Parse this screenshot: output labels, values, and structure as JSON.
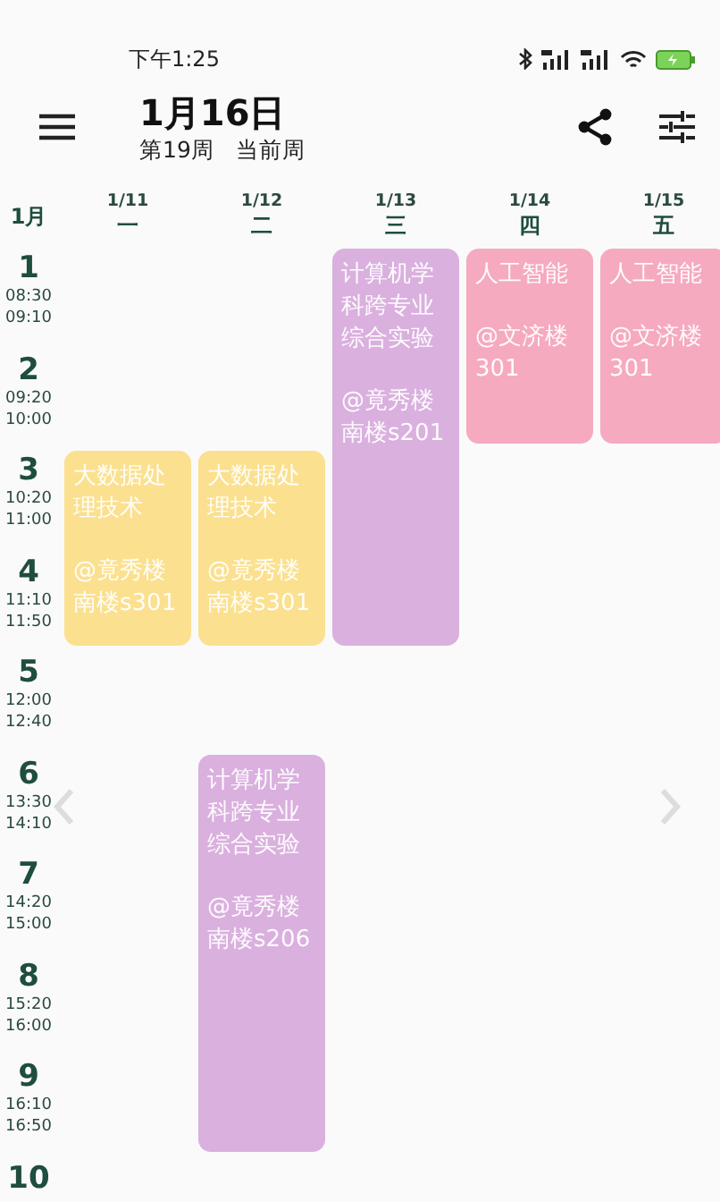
{
  "status_bar": {
    "time": "下午1:25"
  },
  "header": {
    "date": "1月16日",
    "week": "第19周",
    "week_status": "当前周"
  },
  "month": "1月",
  "periods": [
    {
      "number": "1",
      "start": "08:30",
      "end": "09:10"
    },
    {
      "number": "2",
      "start": "09:20",
      "end": "10:00"
    },
    {
      "number": "3",
      "start": "10:20",
      "end": "11:00"
    },
    {
      "number": "4",
      "start": "11:10",
      "end": "11:50"
    },
    {
      "number": "5",
      "start": "12:00",
      "end": "12:40"
    },
    {
      "number": "6",
      "start": "13:30",
      "end": "14:10"
    },
    {
      "number": "7",
      "start": "14:20",
      "end": "15:00"
    },
    {
      "number": "8",
      "start": "15:20",
      "end": "16:00"
    },
    {
      "number": "9",
      "start": "16:10",
      "end": "16:50"
    },
    {
      "number": "10"
    }
  ],
  "days": [
    {
      "date": "1/11",
      "weekday": "一",
      "slots": [
        {
          "kind": "empty"
        },
        {
          "kind": "empty"
        },
        {
          "kind": "course",
          "name": "大数据处理技术",
          "location": "@竟秀楼南楼s301",
          "color": "#fbe08f"
        },
        {
          "kind": "continued"
        }
      ]
    },
    {
      "date": "1/12",
      "weekday": "二",
      "slots": [
        {
          "kind": "empty"
        },
        {
          "kind": "empty"
        },
        {
          "kind": "course",
          "name": "大数据处理技术",
          "location": "@竟秀楼南楼s301",
          "color": "#fbe08f"
        },
        {
          "kind": "continued"
        },
        {
          "kind": "empty"
        },
        {
          "kind": "course",
          "name": "计算机学科跨专业综合实验",
          "location": "@竟秀楼南楼s206",
          "color": "#dab0df"
        },
        {
          "kind": "continued"
        },
        {
          "kind": "continued"
        },
        {
          "kind": "continued"
        }
      ]
    },
    {
      "date": "1/13",
      "weekday": "三",
      "slots": [
        {
          "kind": "course",
          "name": "计算机学科跨专业综合实验",
          "location": "@竟秀楼南楼s201",
          "color": "#dab0df"
        },
        {
          "kind": "continued"
        },
        {
          "kind": "continued"
        },
        {
          "kind": "continued"
        }
      ]
    },
    {
      "date": "1/14",
      "weekday": "四",
      "slots": [
        {
          "kind": "course",
          "name": "人工智能",
          "location": "@文济楼301",
          "color": "#f5aabf"
        },
        {
          "kind": "continued"
        }
      ]
    },
    {
      "date": "1/15",
      "weekday": "五",
      "slots": [
        {
          "kind": "course",
          "name": "人工智能",
          "location": "@文济楼301",
          "color": "#f5aabf"
        },
        {
          "kind": "continued"
        }
      ]
    }
  ]
}
